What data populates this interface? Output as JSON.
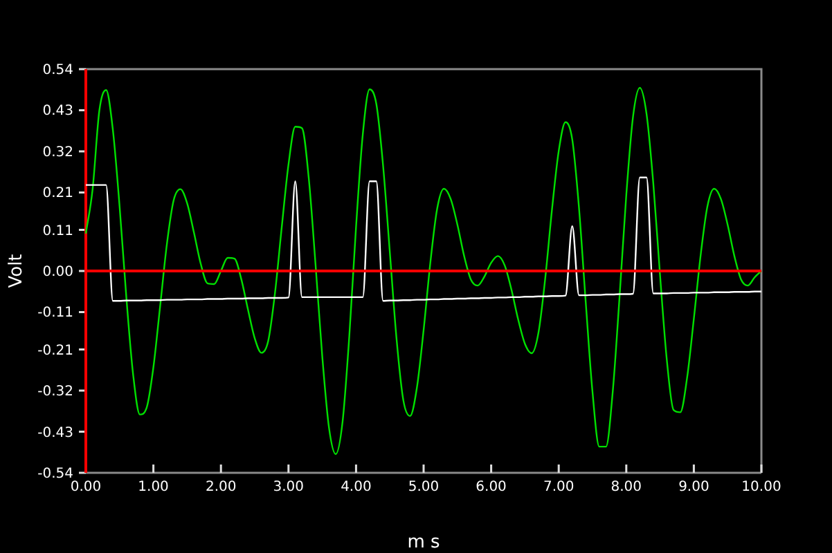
{
  "chart_data": {
    "type": "line",
    "xlabel": "m s",
    "ylabel": "Volt",
    "xlim": [
      0,
      10
    ],
    "ylim": [
      -0.54,
      0.54
    ],
    "xticks": [
      {
        "value": 0,
        "label": "0.00"
      },
      {
        "value": 1,
        "label": "1.00"
      },
      {
        "value": 2,
        "label": "2.00"
      },
      {
        "value": 3,
        "label": "3.00"
      },
      {
        "value": 4,
        "label": "4.00"
      },
      {
        "value": 5,
        "label": "5.00"
      },
      {
        "value": 6,
        "label": "6.00"
      },
      {
        "value": 7,
        "label": "7.00"
      },
      {
        "value": 8,
        "label": "8.00"
      },
      {
        "value": 9,
        "label": "9.00"
      },
      {
        "value": 10,
        "label": "10.00"
      }
    ],
    "yticks": [
      {
        "value": 0.54,
        "label": "0.54"
      },
      {
        "value": 0.43,
        "label": "0.43"
      },
      {
        "value": 0.32,
        "label": "0.32"
      },
      {
        "value": 0.21,
        "label": "0.21"
      },
      {
        "value": 0.11,
        "label": "0.11"
      },
      {
        "value": 0,
        "label": "0.00"
      },
      {
        "value": -0.11,
        "label": "-0.11"
      },
      {
        "value": -0.21,
        "label": "-0.21"
      },
      {
        "value": -0.32,
        "label": "-0.32"
      },
      {
        "value": -0.43,
        "label": "-0.43"
      },
      {
        "value": -0.54,
        "label": "-0.54"
      }
    ],
    "x": [
      0,
      0.1,
      0.2,
      0.3,
      0.4,
      0.5,
      0.6,
      0.7,
      0.8,
      0.9,
      1,
      1.1,
      1.2,
      1.3,
      1.4,
      1.5,
      1.6,
      1.7,
      1.8,
      1.9,
      2,
      2.1,
      2.2,
      2.3,
      2.4,
      2.5,
      2.6,
      2.7,
      2.8,
      2.9,
      3,
      3.1,
      3.2,
      3.3,
      3.4,
      3.5,
      3.6,
      3.7,
      3.8,
      3.9,
      4,
      4.1,
      4.2,
      4.3,
      4.4,
      4.5,
      4.6,
      4.7,
      4.8,
      4.9,
      5,
      5.1,
      5.2,
      5.3,
      5.4,
      5.5,
      5.6,
      5.7,
      5.8,
      5.9,
      6,
      6.1,
      6.2,
      6.3,
      6.4,
      6.5,
      6.6,
      6.7,
      6.8,
      6.9,
      7,
      7.1,
      7.2,
      7.3,
      7.4,
      7.5,
      7.6,
      7.7,
      7.8,
      7.9,
      8,
      8.1,
      8.2,
      8.3,
      8.4,
      8.5,
      8.6,
      8.7,
      8.8,
      8.9,
      9,
      9.1,
      9.2,
      9.3,
      9.4,
      9.5,
      9.6,
      9.7,
      9.8,
      9.9,
      10
    ],
    "series": [
      {
        "color": "#00e000",
        "values": [
          0.1,
          0.218,
          0.429,
          0.484,
          0.378,
          0.172,
          -0.071,
          -0.277,
          -0.384,
          -0.366,
          -0.258,
          -0.094,
          0.072,
          0.189,
          0.219,
          0.181,
          0.103,
          0.02,
          -0.033,
          -0.035,
          0,
          0.035,
          0.033,
          -0.021,
          -0.103,
          -0.18,
          -0.219,
          -0.187,
          -0.059,
          0.117,
          0.285,
          0.386,
          0.382,
          0.248,
          0.018,
          -0.229,
          -0.42,
          -0.49,
          -0.404,
          -0.174,
          0.118,
          0.366,
          0.486,
          0.447,
          0.282,
          0.05,
          -0.183,
          -0.346,
          -0.388,
          -0.313,
          -0.158,
          0.023,
          0.166,
          0.22,
          0.193,
          0.124,
          0.04,
          -0.023,
          -0.039,
          -0.015,
          0.022,
          0.04,
          0.015,
          -0.05,
          -0.13,
          -0.195,
          -0.22,
          -0.165,
          -0.02,
          0.164,
          0.321,
          0.398,
          0.352,
          0.169,
          -0.084,
          -0.324,
          -0.47,
          -0.47,
          -0.322,
          -0.07,
          0.203,
          0.413,
          0.49,
          0.42,
          0.234,
          -0.012,
          -0.238,
          -0.372,
          -0.378,
          -0.286,
          -0.128,
          0.041,
          0.172,
          0.22,
          0.193,
          0.124,
          0.04,
          -0.023,
          -0.039,
          -0.017,
          0
        ]
      },
      {
        "color": "#ffffff",
        "values": [
          0.23,
          0.23,
          0.23,
          0.23,
          -0.08,
          -0.08,
          -0.079,
          -0.079,
          -0.079,
          -0.078,
          -0.078,
          -0.078,
          -0.077,
          -0.077,
          -0.077,
          -0.076,
          -0.076,
          -0.076,
          -0.075,
          -0.075,
          -0.075,
          -0.074,
          -0.074,
          -0.074,
          -0.073,
          -0.073,
          -0.073,
          -0.072,
          -0.072,
          -0.072,
          -0.071,
          0.24,
          -0.07,
          -0.07,
          -0.07,
          -0.07,
          -0.07,
          -0.07,
          -0.07,
          -0.07,
          -0.07,
          -0.07,
          0.24,
          0.24,
          -0.08,
          -0.079,
          -0.079,
          -0.078,
          -0.078,
          -0.077,
          -0.077,
          -0.076,
          -0.076,
          -0.075,
          -0.075,
          -0.074,
          -0.074,
          -0.073,
          -0.073,
          -0.072,
          -0.072,
          -0.071,
          -0.071,
          -0.07,
          -0.07,
          -0.069,
          -0.069,
          -0.068,
          -0.068,
          -0.067,
          -0.067,
          -0.066,
          0.12,
          -0.065,
          -0.065,
          -0.064,
          -0.064,
          -0.063,
          -0.063,
          -0.062,
          -0.062,
          -0.061,
          0.25,
          0.25,
          -0.06,
          -0.06,
          -0.06,
          -0.059,
          -0.059,
          -0.059,
          -0.058,
          -0.058,
          -0.058,
          -0.057,
          -0.057,
          -0.057,
          -0.056,
          -0.056,
          -0.056,
          -0.055,
          -0.055
        ]
      },
      {
        "color": "#ff0000",
        "values": [
          0,
          0,
          0,
          0,
          0,
          0,
          0,
          0,
          0,
          0,
          0,
          0,
          0,
          0,
          0,
          0,
          0,
          0,
          0,
          0,
          0,
          0,
          0,
          0,
          0,
          0,
          0,
          0,
          0,
          0,
          0,
          0,
          0,
          0,
          0,
          0,
          0,
          0,
          0,
          0,
          0,
          0,
          0,
          0,
          0,
          0,
          0,
          0,
          0,
          0,
          0,
          0,
          0,
          0,
          0,
          0,
          0,
          0,
          0,
          0,
          0,
          0,
          0,
          0,
          0,
          0,
          0,
          0,
          0,
          0,
          0,
          0,
          0,
          0,
          0,
          0,
          0,
          0,
          0,
          0,
          0,
          0,
          0,
          0,
          0,
          0,
          0,
          0,
          0,
          0,
          0,
          0,
          0,
          0,
          0,
          0,
          0,
          0,
          0,
          0,
          0
        ]
      }
    ]
  }
}
